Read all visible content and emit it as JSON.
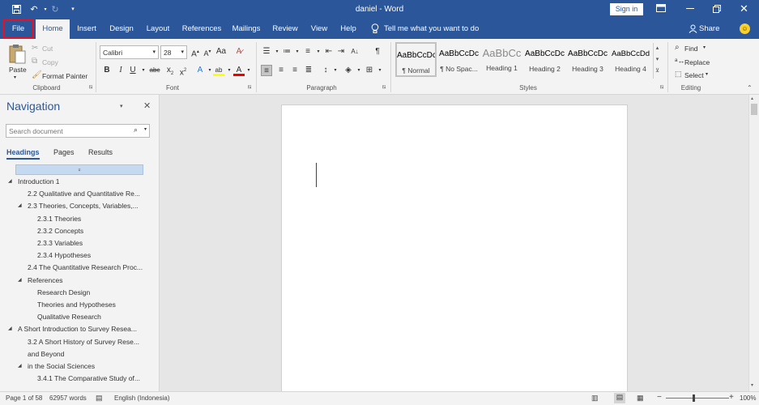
{
  "titlebar": {
    "title": "daniel  -  Word",
    "sign_in": "Sign in"
  },
  "tabs": {
    "file": "File",
    "home": "Home",
    "insert": "Insert",
    "design": "Design",
    "layout": "Layout",
    "references": "References",
    "mailings": "Mailings",
    "review": "Review",
    "view": "View",
    "help": "Help",
    "tell_me": "Tell me what you want to do",
    "share": "Share"
  },
  "clipboard": {
    "paste": "Paste",
    "cut": "Cut",
    "copy": "Copy",
    "format_painter": "Format Painter",
    "label": "Clipboard"
  },
  "font": {
    "name": "Calibri",
    "size": "28",
    "label": "Font"
  },
  "paragraph": {
    "label": "Paragraph"
  },
  "styles": {
    "label": "Styles",
    "items": [
      {
        "preview": "AaBbCcDc",
        "name": "¶ Normal"
      },
      {
        "preview": "AaBbCcDc",
        "name": "¶ No Spac..."
      },
      {
        "preview": "AaBbCc",
        "name": "Heading 1"
      },
      {
        "preview": "AaBbCcDc",
        "name": "Heading 2"
      },
      {
        "preview": "AaBbCcDc",
        "name": "Heading 3"
      },
      {
        "preview": "AaBbCcDd",
        "name": "Heading 4"
      }
    ]
  },
  "editing": {
    "find": "Find",
    "replace": "Replace",
    "select": "Select",
    "label": "Editing"
  },
  "navigation": {
    "title": "Navigation",
    "search_placeholder": "Search document",
    "tab_headings": "Headings",
    "tab_pages": "Pages",
    "tab_results": "Results",
    "items": [
      {
        "text": "Introduction 1",
        "level": 0,
        "expand": true
      },
      {
        "text": "2.2 Qualitative and Quantitative Re...",
        "level": 1,
        "expand": false
      },
      {
        "text": "2.3 Theories, Concepts, Variables,...",
        "level": 1,
        "expand": true
      },
      {
        "text": "2.3.1 Theories",
        "level": 2,
        "expand": false
      },
      {
        "text": "2.3.2 Concepts",
        "level": 2,
        "expand": false
      },
      {
        "text": "2.3.3 Variables",
        "level": 2,
        "expand": false
      },
      {
        "text": "2.3.4 Hypotheses",
        "level": 2,
        "expand": false
      },
      {
        "text": "2.4 The Quantitative Research Proc...",
        "level": 1,
        "expand": false
      },
      {
        "text": "References",
        "level": 1,
        "expand": true
      },
      {
        "text": "Research Design",
        "level": 2,
        "expand": false
      },
      {
        "text": "Theories and Hypotheses",
        "level": 2,
        "expand": false
      },
      {
        "text": "Qualitative Research",
        "level": 2,
        "expand": false
      },
      {
        "text": "A Short Introduction to Survey Resea...",
        "level": 0,
        "expand": true
      },
      {
        "text": "3.2 A Short History of Survey Rese...",
        "level": 1,
        "expand": false
      },
      {
        "text": "and Beyond",
        "level": 1,
        "expand": false
      },
      {
        "text": "in the Social Sciences",
        "level": 1,
        "expand": true
      },
      {
        "text": "3.4.1 The Comparative Study of...",
        "level": 2,
        "expand": false
      }
    ]
  },
  "status": {
    "page": "Page 1 of 58",
    "words": "62957 words",
    "language": "English (Indonesia)",
    "zoom": "100%"
  },
  "colors": {
    "accent": "#2b579a",
    "highlight": "#e81123"
  }
}
